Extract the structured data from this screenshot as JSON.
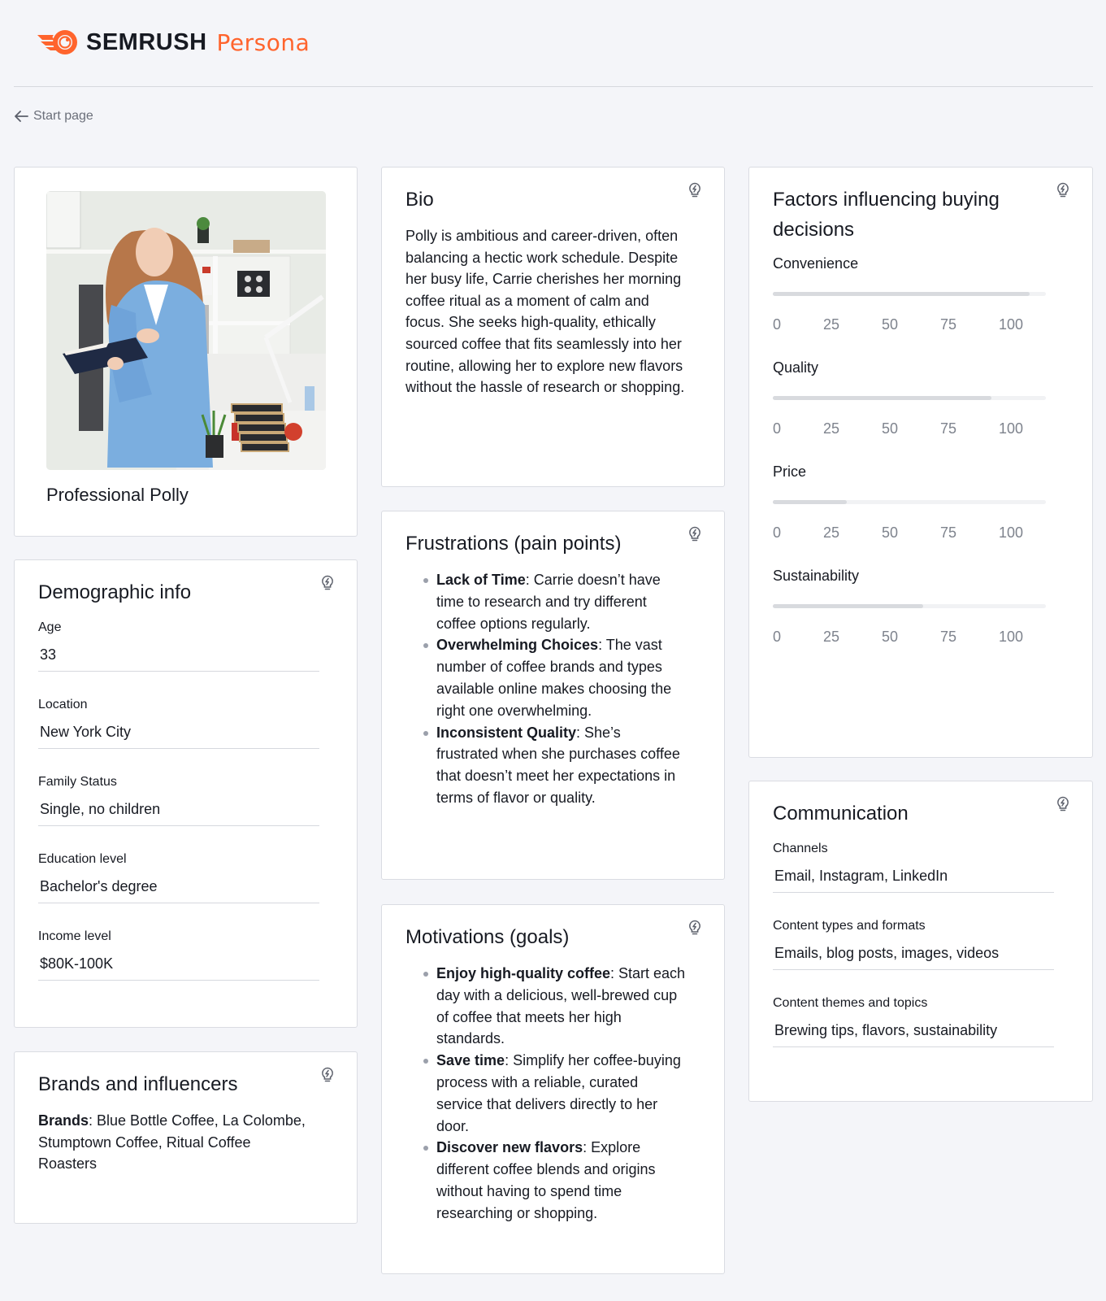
{
  "brand": {
    "name": "SEMRUSH",
    "product": "Persona",
    "accent_color": "#ff642d"
  },
  "nav": {
    "back_label": "Start page",
    "back_icon": "arrow-left-icon"
  },
  "profile": {
    "name": "Professional Polly",
    "photo_alt": "Woman in a blue suit holding a notebook in an office"
  },
  "demographic": {
    "title": "Demographic info",
    "fields": [
      {
        "label": "Age",
        "value": "33"
      },
      {
        "label": "Location",
        "value": "New York City"
      },
      {
        "label": "Family Status",
        "value": "Single, no children"
      },
      {
        "label": "Education level",
        "value": "Bachelor's degree"
      },
      {
        "label": "Income level",
        "value": "$80K-100K"
      }
    ]
  },
  "brands": {
    "title": "Brands and influencers",
    "label": "Brands",
    "text": ": Blue Bottle Coffee, La Colombe, Stumptown Coffee, Ritual Coffee Roasters"
  },
  "bio": {
    "title": "Bio",
    "text": "Polly is ambitious and career-driven, often balancing a hectic work schedule. Despite her busy life, Carrie cherishes her morning coffee ritual as a moment of calm and focus. She seeks high-quality, ethically sourced coffee that fits seamlessly into her routine, allowing her to explore new flavors without the hassle of research or shopping."
  },
  "frustrations": {
    "title": "Frustrations (pain points)",
    "items": [
      {
        "bold": "Lack of Time",
        "text": ": Carrie doesn’t have time to research and try different coffee options regularly."
      },
      {
        "bold": "Overwhelming Choices",
        "text": ": The vast number of coffee brands and types available online makes choosing the right one overwhelming."
      },
      {
        "bold": "Inconsistent Quality",
        "text": ": She’s frustrated when she purchases coffee that doesn’t meet her expectations in terms of flavor or quality."
      }
    ]
  },
  "motivations": {
    "title": "Motivations (goals)",
    "items": [
      {
        "bold": "Enjoy high-quality coffee",
        "text": ": Start each day with a delicious, well-brewed cup of coffee that meets her high standards."
      },
      {
        "bold": "Save time",
        "text": ": Simplify her coffee-buying process with a reliable, curated service that delivers directly to her door."
      },
      {
        "bold": "Discover new flavors",
        "text": ": Explore different coffee blends and origins without having to spend time researching or shopping."
      }
    ]
  },
  "factors": {
    "title": "Factors influencing buying decisions",
    "scale_ticks": [
      "0",
      "25",
      "50",
      "75",
      "100"
    ],
    "items": [
      {
        "label": "Convenience",
        "value": 94
      },
      {
        "label": "Quality",
        "value": 80
      },
      {
        "label": "Price",
        "value": 27
      },
      {
        "label": "Sustainability",
        "value": 55
      }
    ]
  },
  "communication": {
    "title": "Communication",
    "fields": [
      {
        "label": "Channels",
        "value": "Email, Instagram, LinkedIn"
      },
      {
        "label": "Content types and formats",
        "value": "Emails, blog posts, images, videos"
      },
      {
        "label": "Content themes and topics",
        "value": "Brewing tips, flavors, sustainability"
      }
    ]
  },
  "icons": {
    "hint": "lightbulb-bolt-icon"
  }
}
